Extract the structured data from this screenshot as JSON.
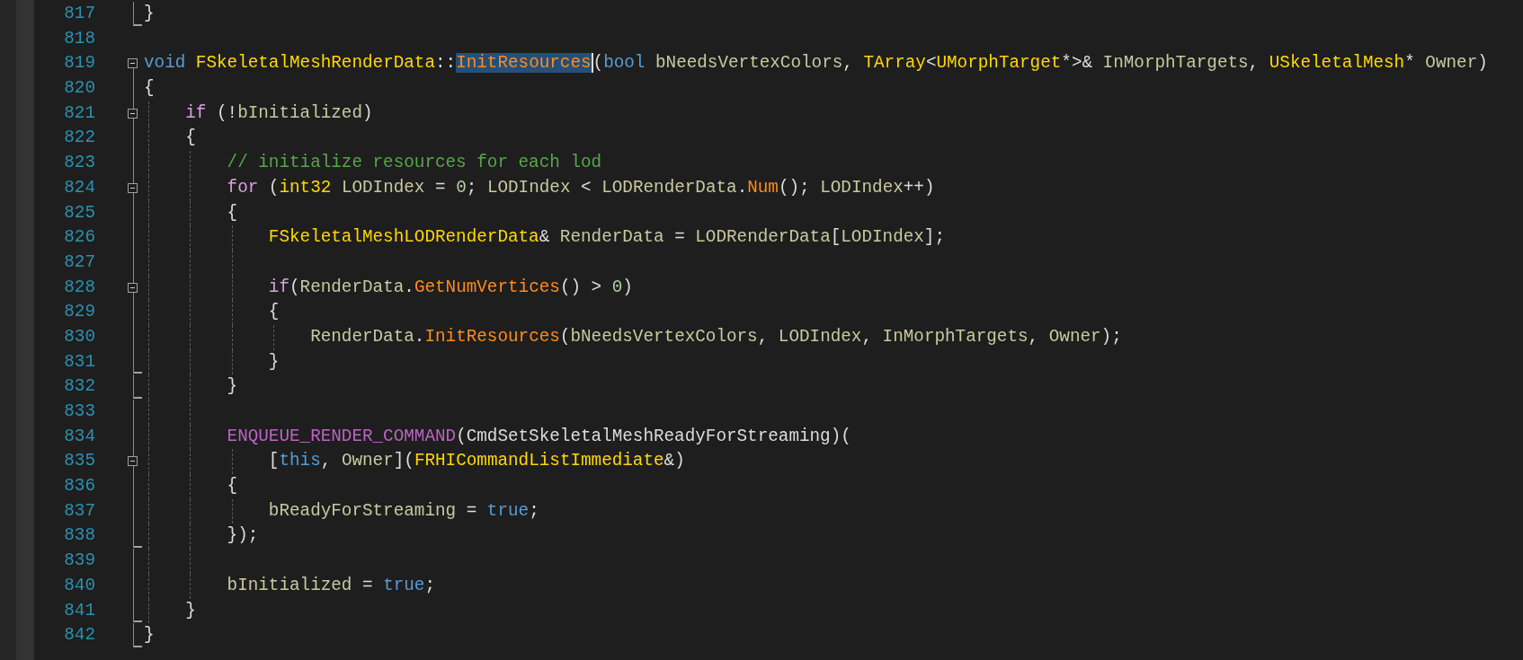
{
  "editor": {
    "lines": [
      {
        "number": "817",
        "collapsible": false,
        "in_region": true,
        "region_end": true,
        "tokens": [
          {
            "kind": "plain",
            "text": "}"
          }
        ]
      },
      {
        "number": "818",
        "collapsible": false,
        "in_region": false,
        "region_end": false
      },
      {
        "number": "819",
        "collapsible": true,
        "in_region": false,
        "region_end": false,
        "tokens": [
          {
            "kind": "keyword",
            "text": "void "
          },
          {
            "kind": "type",
            "text": "FSkeletalMeshRenderData"
          },
          {
            "kind": "plain",
            "text": "::"
          },
          {
            "kind": "selection",
            "text": "InitResources"
          },
          {
            "kind": "plain",
            "text": "("
          },
          {
            "kind": "keyword",
            "text": "bool "
          },
          {
            "kind": "ident",
            "text": "bNeedsVertexColors"
          },
          {
            "kind": "plain",
            "text": ", "
          },
          {
            "kind": "type",
            "text": "TArray"
          },
          {
            "kind": "plain",
            "text": "<"
          },
          {
            "kind": "type",
            "text": "UMorphTarget"
          },
          {
            "kind": "plain",
            "text": "*>& "
          },
          {
            "kind": "ident",
            "text": "InMorphTargets"
          },
          {
            "kind": "plain",
            "text": ", "
          },
          {
            "kind": "type",
            "text": "USkeletalMesh"
          },
          {
            "kind": "plain",
            "text": "* "
          },
          {
            "kind": "ident",
            "text": "Owner"
          },
          {
            "kind": "plain",
            "text": ")"
          }
        ]
      },
      {
        "number": "820",
        "collapsible": false,
        "in_region": true,
        "region_end": false,
        "tokens": [
          {
            "kind": "plain",
            "text": "{"
          }
        ]
      },
      {
        "number": "821",
        "collapsible": true,
        "in_region": true,
        "region_end": false,
        "tokens": [
          {
            "kind": "control",
            "text": "    if"
          },
          {
            "kind": "plain",
            "text": " (!"
          },
          {
            "kind": "ident",
            "text": "bInitialized"
          },
          {
            "kind": "plain",
            "text": ")"
          }
        ]
      },
      {
        "number": "822",
        "collapsible": false,
        "in_region": true,
        "region_end": false,
        "tokens": [
          {
            "kind": "plain",
            "text": "    {"
          }
        ]
      },
      {
        "number": "823",
        "collapsible": false,
        "in_region": true,
        "region_end": false,
        "tokens": [
          {
            "kind": "comment",
            "text": "        // initialize resources for each lod"
          }
        ]
      },
      {
        "number": "824",
        "collapsible": true,
        "in_region": true,
        "region_end": false,
        "tokens": [
          {
            "kind": "control",
            "text": "        for"
          },
          {
            "kind": "plain",
            "text": " ("
          },
          {
            "kind": "type",
            "text": "int32 "
          },
          {
            "kind": "ident",
            "text": "LODIndex"
          },
          {
            "kind": "plain",
            "text": " = "
          },
          {
            "kind": "number",
            "text": "0"
          },
          {
            "kind": "plain",
            "text": "; "
          },
          {
            "kind": "ident",
            "text": "LODIndex"
          },
          {
            "kind": "plain",
            "text": " < "
          },
          {
            "kind": "ident",
            "text": "LODRenderData"
          },
          {
            "kind": "plain",
            "text": "."
          },
          {
            "kind": "func",
            "text": "Num"
          },
          {
            "kind": "plain",
            "text": "(); "
          },
          {
            "kind": "ident",
            "text": "LODIndex"
          },
          {
            "kind": "plain",
            "text": "++)"
          }
        ]
      },
      {
        "number": "825",
        "collapsible": false,
        "in_region": true,
        "region_end": false,
        "tokens": [
          {
            "kind": "plain",
            "text": "        {"
          }
        ]
      },
      {
        "number": "826",
        "collapsible": false,
        "in_region": true,
        "region_end": false,
        "tokens": [
          {
            "kind": "type",
            "text": "            FSkeletalMeshLODRenderData"
          },
          {
            "kind": "plain",
            "text": "& "
          },
          {
            "kind": "ident",
            "text": "RenderData"
          },
          {
            "kind": "plain",
            "text": " = "
          },
          {
            "kind": "ident",
            "text": "LODRenderData"
          },
          {
            "kind": "plain",
            "text": "["
          },
          {
            "kind": "ident",
            "text": "LODIndex"
          },
          {
            "kind": "plain",
            "text": "];"
          }
        ]
      },
      {
        "number": "827",
        "collapsible": false,
        "in_region": true,
        "region_end": false
      },
      {
        "number": "828",
        "collapsible": true,
        "in_region": true,
        "region_end": false,
        "tokens": [
          {
            "kind": "control",
            "text": "            if"
          },
          {
            "kind": "plain",
            "text": "("
          },
          {
            "kind": "ident",
            "text": "RenderData"
          },
          {
            "kind": "plain",
            "text": "."
          },
          {
            "kind": "func",
            "text": "GetNumVertices"
          },
          {
            "kind": "plain",
            "text": "() > "
          },
          {
            "kind": "number",
            "text": "0"
          },
          {
            "kind": "plain",
            "text": ")"
          }
        ]
      },
      {
        "number": "829",
        "collapsible": false,
        "in_region": true,
        "region_end": false,
        "tokens": [
          {
            "kind": "plain",
            "text": "            {"
          }
        ]
      },
      {
        "number": "830",
        "collapsible": false,
        "in_region": true,
        "region_end": false,
        "tokens": [
          {
            "kind": "ident",
            "text": "                RenderData"
          },
          {
            "kind": "plain",
            "text": "."
          },
          {
            "kind": "func",
            "text": "InitResources"
          },
          {
            "kind": "plain",
            "text": "("
          },
          {
            "kind": "ident",
            "text": "bNeedsVertexColors"
          },
          {
            "kind": "plain",
            "text": ", "
          },
          {
            "kind": "ident",
            "text": "LODIndex"
          },
          {
            "kind": "plain",
            "text": ", "
          },
          {
            "kind": "ident",
            "text": "InMorphTargets"
          },
          {
            "kind": "plain",
            "text": ", "
          },
          {
            "kind": "ident",
            "text": "Owner"
          },
          {
            "kind": "plain",
            "text": ");"
          }
        ]
      },
      {
        "number": "831",
        "collapsible": false,
        "in_region": true,
        "region_end": true,
        "tokens": [
          {
            "kind": "plain",
            "text": "            }"
          }
        ]
      },
      {
        "number": "832",
        "collapsible": false,
        "in_region": true,
        "region_end": true,
        "tokens": [
          {
            "kind": "plain",
            "text": "        }"
          }
        ]
      },
      {
        "number": "833",
        "collapsible": false,
        "in_region": true,
        "region_end": false
      },
      {
        "number": "834",
        "collapsible": false,
        "in_region": true,
        "region_end": false,
        "tokens": [
          {
            "kind": "macro",
            "text": "        ENQUEUE_RENDER_COMMAND"
          },
          {
            "kind": "plain",
            "text": "(CmdSetSkeletalMeshReadyForStreaming)("
          }
        ]
      },
      {
        "number": "835",
        "collapsible": true,
        "in_region": true,
        "region_end": false,
        "tokens": [
          {
            "kind": "plain",
            "text": "            ["
          },
          {
            "kind": "keyword",
            "text": "this"
          },
          {
            "kind": "plain",
            "text": ", "
          },
          {
            "kind": "ident",
            "text": "Owner"
          },
          {
            "kind": "plain",
            "text": "]("
          },
          {
            "kind": "type",
            "text": "FRHICommandListImmediate"
          },
          {
            "kind": "plain",
            "text": "&)"
          }
        ]
      },
      {
        "number": "836",
        "collapsible": false,
        "in_region": true,
        "region_end": false,
        "tokens": [
          {
            "kind": "plain",
            "text": "        {"
          }
        ]
      },
      {
        "number": "837",
        "collapsible": false,
        "in_region": true,
        "region_end": false,
        "tokens": [
          {
            "kind": "ident",
            "text": "            bReadyForStreaming"
          },
          {
            "kind": "plain",
            "text": " = "
          },
          {
            "kind": "keyword",
            "text": "true"
          },
          {
            "kind": "plain",
            "text": ";"
          }
        ]
      },
      {
        "number": "838",
        "collapsible": false,
        "in_region": true,
        "region_end": true,
        "tokens": [
          {
            "kind": "plain",
            "text": "        });"
          }
        ]
      },
      {
        "number": "839",
        "collapsible": false,
        "in_region": true,
        "region_end": false
      },
      {
        "number": "840",
        "collapsible": false,
        "in_region": true,
        "region_end": false,
        "tokens": [
          {
            "kind": "ident",
            "text": "        bInitialized"
          },
          {
            "kind": "plain",
            "text": " = "
          },
          {
            "kind": "keyword",
            "text": "true"
          },
          {
            "kind": "plain",
            "text": ";"
          }
        ]
      },
      {
        "number": "841",
        "collapsible": false,
        "in_region": true,
        "region_end": true,
        "tokens": [
          {
            "kind": "plain",
            "text": "    }"
          }
        ]
      },
      {
        "number": "842",
        "collapsible": false,
        "in_region": true,
        "region_end": true,
        "tokens": [
          {
            "kind": "plain",
            "text": "}"
          }
        ]
      }
    ]
  }
}
